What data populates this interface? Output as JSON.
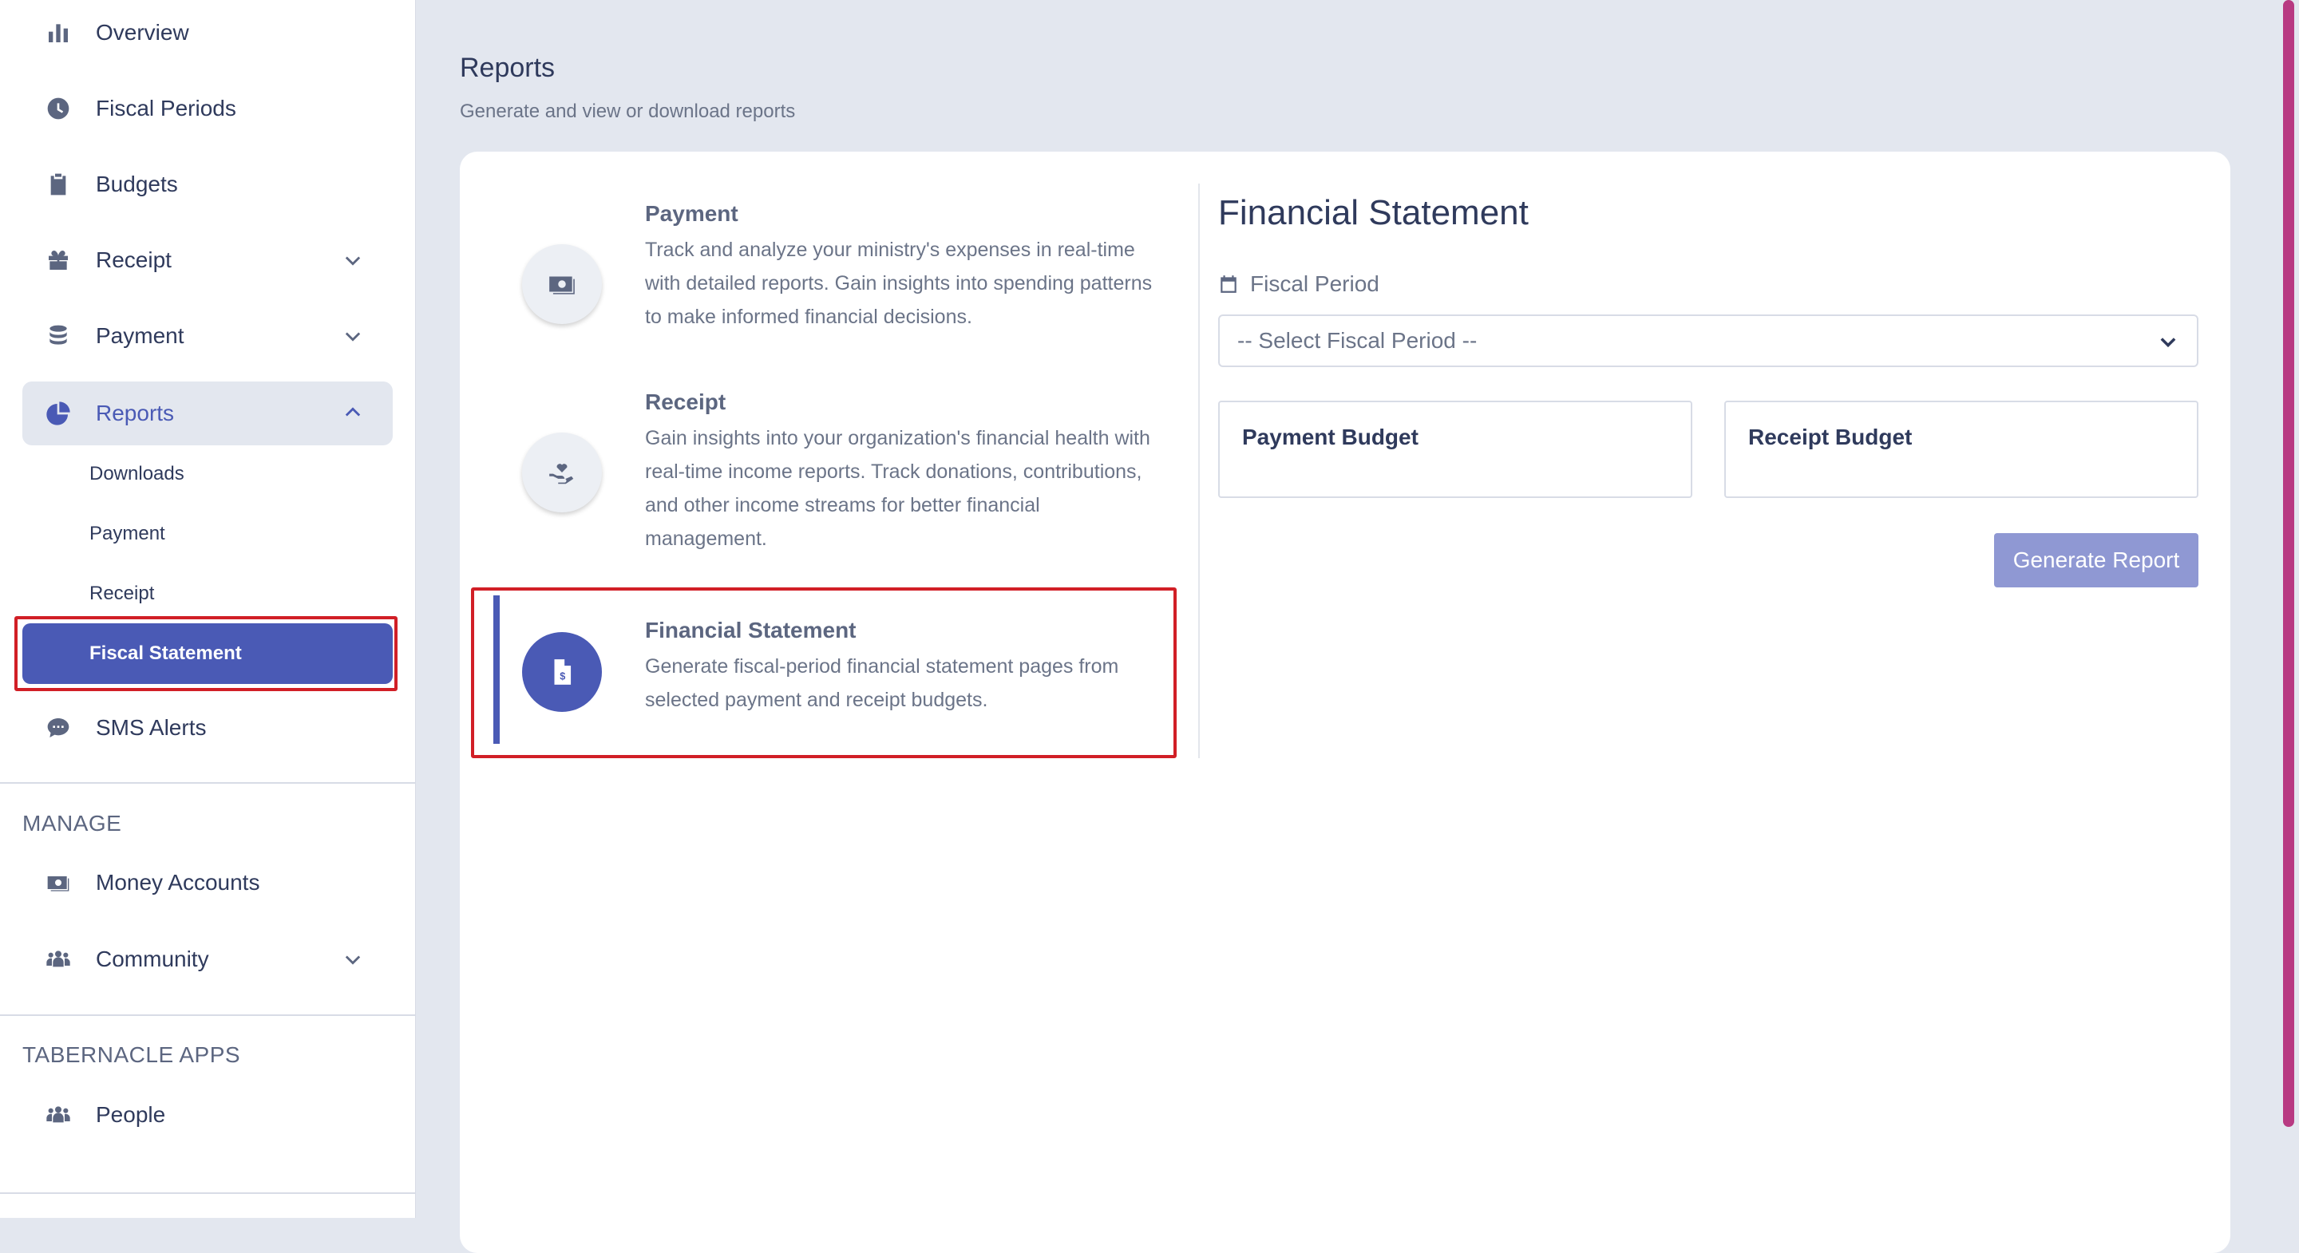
{
  "sidebar": {
    "items": [
      {
        "label": "Overview",
        "icon": "bar-chart-icon"
      },
      {
        "label": "Fiscal Periods",
        "icon": "clock-icon"
      },
      {
        "label": "Budgets",
        "icon": "clipboard-icon"
      },
      {
        "label": "Receipt",
        "icon": "gift-icon"
      },
      {
        "label": "Payment",
        "icon": "coins-icon"
      },
      {
        "label": "Reports",
        "icon": "pie-chart-icon"
      }
    ],
    "reports_sub": [
      "Downloads",
      "Payment",
      "Receipt",
      "Fiscal Statement"
    ],
    "sms": {
      "label": "SMS Alerts",
      "icon": "chat-icon"
    },
    "manage_heading": "MANAGE",
    "manage_items": [
      {
        "label": "Money Accounts",
        "icon": "money-icon"
      },
      {
        "label": "Community",
        "icon": "users-icon"
      }
    ],
    "apps_heading": "TABERNACLE APPS",
    "apps_items": [
      {
        "label": "People",
        "icon": "users-icon"
      }
    ]
  },
  "main": {
    "title": "Reports",
    "subtitle": "Generate and view or download reports",
    "report_types": [
      {
        "title": "Payment",
        "description": "Track and analyze your ministry's expenses in real-time with detailed reports. Gain insights into spending patterns to make informed financial decisions.",
        "icon": "money-icon"
      },
      {
        "title": "Receipt",
        "description": "Gain insights into your organization's financial health with real-time income reports. Track donations, contributions, and other income streams for better financial management.",
        "icon": "hand-heart-icon"
      },
      {
        "title": "Financial Statement",
        "description": "Generate fiscal-period financial statement pages from selected payment and receipt budgets.",
        "icon": "invoice-icon"
      }
    ],
    "panel": {
      "title": "Financial Statement",
      "fiscal_period_label": "Fiscal Period",
      "select_value": "-- Select Fiscal Period --",
      "payment_budget": "Payment Budget",
      "receipt_budget": "Receipt Budget",
      "generate_button": "Generate Report"
    }
  },
  "colors": {
    "accent": "#4a5ab5",
    "button_disabled": "#8f98d3",
    "highlight_red": "#d11f26",
    "background": "#e3e7ef"
  }
}
